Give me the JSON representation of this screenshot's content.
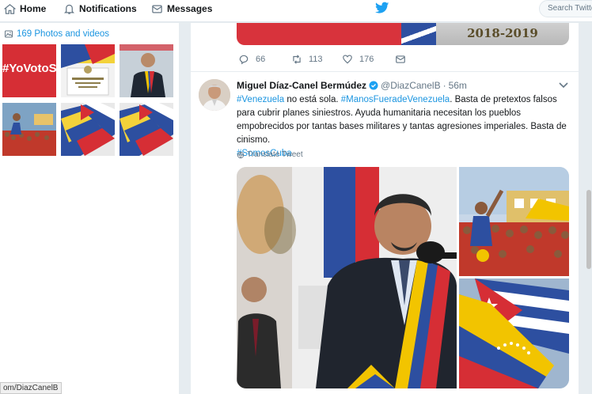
{
  "nav": {
    "home_label": "Home",
    "notifications_label": "Notifications",
    "messages_label": "Messages",
    "search_placeholder": "Search Twitter"
  },
  "sidebar": {
    "photos_label": "169 Photos and videos",
    "thumbnails": [
      {
        "text": "#YoVotoSí"
      },
      {
        "caption": "REFORMA CONSTITUCIONAL 2018-2019"
      }
    ]
  },
  "previous_tweet": {
    "media_year": "2018-2019",
    "replies": "66",
    "retweets": "113",
    "likes": "176"
  },
  "tweet": {
    "name": "Miguel Díaz-Canel Bermúdez",
    "handle": "@DiazCanelB",
    "separator": "·",
    "time": "56m",
    "text": {
      "hashtag1": "#Venezuela",
      "part1": " no está sola. ",
      "hashtag2": "#ManosFueradeVenezuela",
      "part2": ". Basta de pretextos falsos para cubrir planes siniestros. Ayuda humanitaria necesitan los pueblos empobrecidos por tantas bases militares y tantas agresiones imperiales. Basta de cinismo.",
      "hashtag3": "#SomosCuba"
    },
    "translate_label": "Translate Tweet"
  },
  "status_url": "om/DiazCanelB",
  "colors": {
    "accent": "#1b95e0",
    "twitter_blue": "#1da1f2",
    "background": "#e6ecf0"
  }
}
